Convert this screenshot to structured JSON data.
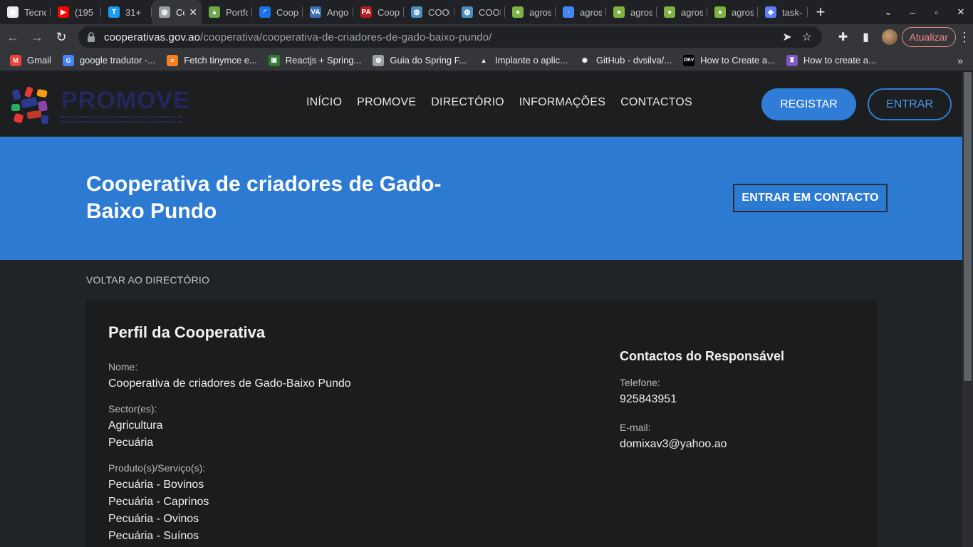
{
  "browser": {
    "tabs": [
      {
        "title": "Tecno",
        "fav_color": "#e8eaed",
        "fav_glyph": "◉"
      },
      {
        "title": "(195",
        "fav_color": "#ff0000",
        "fav_glyph": "▶"
      },
      {
        "title": "31+",
        "fav_color": "#1d9bf0",
        "fav_glyph": "T"
      },
      {
        "title": "Co",
        "fav_color": "#9aa0a6",
        "fav_glyph": "◍",
        "active": true
      },
      {
        "title": "Portfo",
        "fav_color": "#6aa84f",
        "fav_glyph": "▲"
      },
      {
        "title": "Coop",
        "fav_color": "#1a73e8",
        "fav_glyph": "◜"
      },
      {
        "title": "Ango",
        "fav_color": "#3c6fb6",
        "fav_glyph": "VA"
      },
      {
        "title": "Coop",
        "fav_color": "#b71c1c",
        "fav_glyph": "PA"
      },
      {
        "title": "COOF",
        "fav_color": "#4a90c2",
        "fav_glyph": "◍"
      },
      {
        "title": "COOF",
        "fav_color": "#4a90c2",
        "fav_glyph": "◍"
      },
      {
        "title": "agros",
        "fav_color": "#7cb342",
        "fav_glyph": "●"
      },
      {
        "title": "agros",
        "fav_color": "#4285f4",
        "fav_glyph": "·"
      },
      {
        "title": "agros",
        "fav_color": "#7cb342",
        "fav_glyph": "●"
      },
      {
        "title": "agros",
        "fav_color": "#7cb342",
        "fav_glyph": "●"
      },
      {
        "title": "agros",
        "fav_color": "#7cb342",
        "fav_glyph": "●"
      },
      {
        "title": "task-",
        "fav_color": "#5c7cfa",
        "fav_glyph": "◆"
      }
    ],
    "new_tab_label": "+",
    "url_host": "cooperativas.gov.ao",
    "url_path": "/cooperativa/cooperativa-de-criadores-de-gado-baixo-pundo/",
    "update_label": "Atualizar",
    "bookmarks": [
      {
        "label": "Gmail",
        "fav_color": "#ea4335",
        "fav_glyph": "M"
      },
      {
        "label": "google tradutor -...",
        "fav_color": "#4285f4",
        "fav_glyph": "G"
      },
      {
        "label": "Fetch tinymce e...",
        "fav_color": "#f48024",
        "fav_glyph": "≡"
      },
      {
        "label": "Reactjs + Spring...",
        "fav_color": "#2e7d32",
        "fav_glyph": "▣"
      },
      {
        "label": "Guia do Spring F...",
        "fav_color": "#9aa0a6",
        "fav_glyph": "◍"
      },
      {
        "label": "Implante o aplic...",
        "fav_color": "#35363a",
        "fav_glyph": "▲"
      },
      {
        "label": "GitHub - dvsilva/...",
        "fav_color": "#35363a",
        "fav_glyph": "◉"
      },
      {
        "label": "How to Create a...",
        "fav_color": "#000000",
        "fav_glyph": "DEV"
      },
      {
        "label": "How to create a...",
        "fav_color": "#7e57c2",
        "fav_glyph": "♜"
      }
    ]
  },
  "site": {
    "logo_text": "PROMOVE",
    "nav": [
      "INÍCIO",
      "PROMOVE",
      "DIRECTÓRIO",
      "INFORMAÇÕES",
      "CONTACTOS"
    ],
    "register_label": "REGISTAR",
    "login_label": "ENTRAR"
  },
  "hero": {
    "title": "Cooperativa de criadores de Gado-Baixo Pundo",
    "contact_button": "ENTRAR EM CONTACTO"
  },
  "back_link": "VOLTAR AO DIRECTÓRIO",
  "profile": {
    "heading": "Perfil da Cooperativa",
    "name_label": "Nome:",
    "name_value": "Cooperativa de criadores de Gado-Baixo Pundo",
    "sectors_label": "Sector(es):",
    "sectors": [
      "Agricultura",
      "Pecuária"
    ],
    "products_label": "Produto(s)/Serviço(s):",
    "products": [
      "Pecuária - Bovinos",
      "Pecuária - Caprinos",
      "Pecuária - Ovinos",
      "Pecuária - Suínos"
    ]
  },
  "contacts": {
    "heading": "Contactos do Responsável",
    "phone_label": "Telefone:",
    "phone_value": "925843951",
    "email_label": "E-mail:",
    "email_value": "domixav3@yahoo.ao"
  },
  "colors": {
    "hero_bg": "#2c7ad2",
    "primary_button": "#2f7dd6",
    "page_bg": "#212427",
    "card_bg": "#1a1c1e"
  }
}
